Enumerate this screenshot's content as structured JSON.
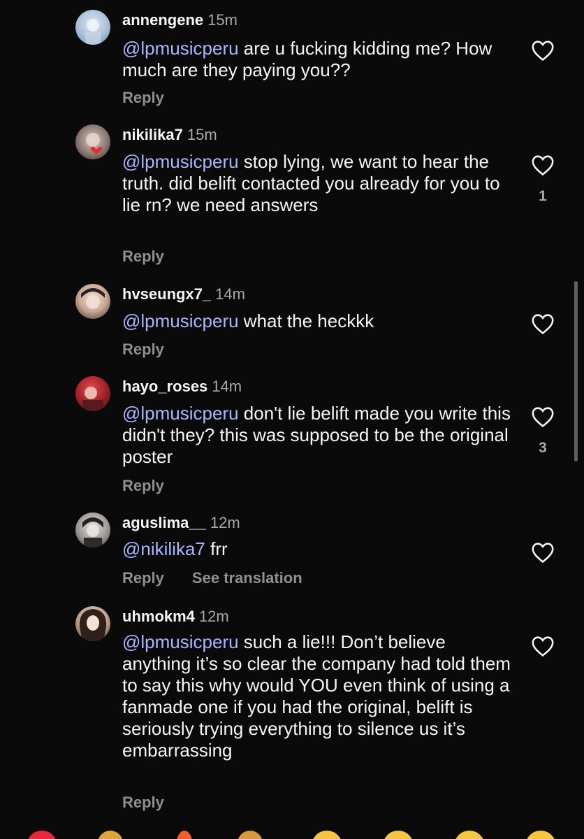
{
  "comments": [
    {
      "username": "annengene",
      "time": "15m",
      "mention": "@lpmusicperu",
      "text": " are u fucking kidding me? How much are they paying you??",
      "reply": "Reply",
      "likes": ""
    },
    {
      "username": "nikilika7",
      "time": "15m",
      "mention": "@lpmusicperu",
      "text": " stop lying, we want to hear the truth. did belift contacted you already for you to lie rn? we need answers",
      "reply": "Reply",
      "likes": "1"
    },
    {
      "username": "hvseungx7_",
      "time": "14m",
      "mention": "@lpmusicperu",
      "text": " what the heckkk",
      "reply": "Reply",
      "likes": ""
    },
    {
      "username": "hayo_roses",
      "time": "14m",
      "mention": "@lpmusicperu",
      "text": " don't lie belift made you write this didn't they? this was supposed to be the original poster",
      "reply": "Reply",
      "likes": "3"
    },
    {
      "username": "aguslima__",
      "time": "12m",
      "mention": "@nikilika7",
      "text": " frr",
      "reply": "Reply",
      "see_translation": "See translation",
      "likes": ""
    },
    {
      "username": "uhmokm4",
      "time": "12m",
      "mention": "@lpmusicperu",
      "text": " such a lie!!! Don’t believe anything it’s so clear the company had told them to say this why would YOU even think of using a fanmade one if you had the original, belift is seriously trying everything to silence us it’s embarrassing",
      "reply": "Reply",
      "likes": ""
    }
  ],
  "icons": {
    "like": "heart-outline-icon",
    "avatar": "user-avatar"
  },
  "colors": {
    "background": "#0a0a0b",
    "mention": "#a9b6ff",
    "secondary_text": "#a8a8a8"
  }
}
